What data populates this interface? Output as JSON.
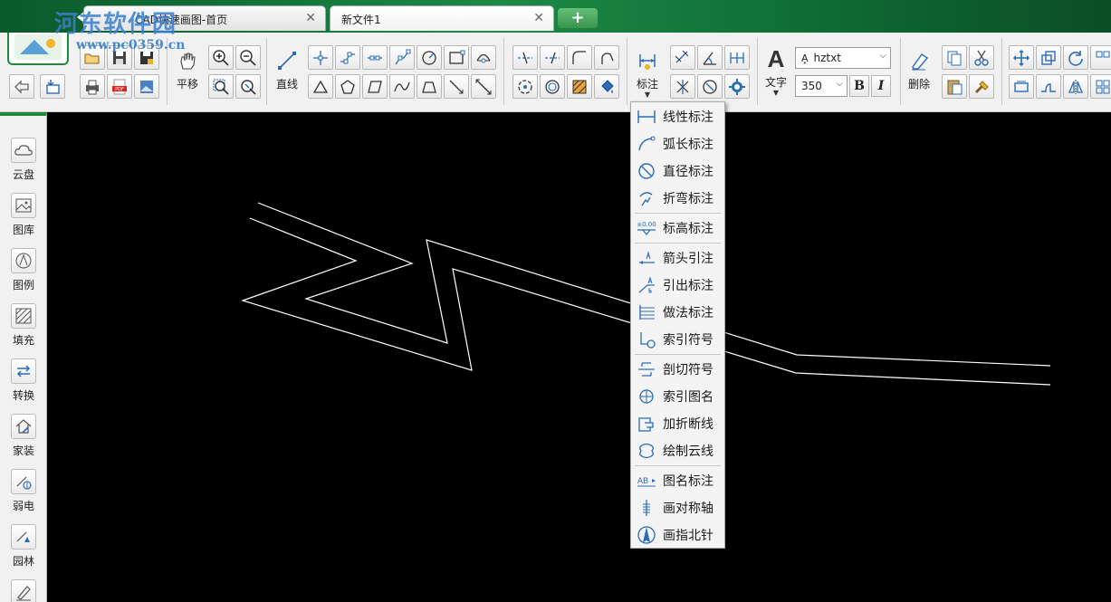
{
  "window": {
    "watermark": "河东软件园",
    "watermark_url": "www.pc0359.cn"
  },
  "tabs": [
    {
      "label": "CAD快速画图-首页",
      "close": "✕"
    },
    {
      "label": "新文件1",
      "close": "✕"
    }
  ],
  "add_tab": "+",
  "ribbon": {
    "pan_label": "平移",
    "line_label": "直线",
    "dim_label": "标注",
    "text_label": "文字",
    "text_glyph": "A",
    "delete_label": "删除",
    "font_select": "hztxt",
    "font_select_prefix": "A͓",
    "size_select": "350",
    "bold": "B",
    "italic": "I"
  },
  "left_palette": [
    {
      "label": "云盘",
      "icon": "cloud-icon"
    },
    {
      "label": "图库",
      "icon": "gallery-icon"
    },
    {
      "label": "图例",
      "icon": "legend-icon"
    },
    {
      "label": "填充",
      "icon": "hatch-icon"
    },
    {
      "label": "转换",
      "icon": "convert-icon"
    },
    {
      "label": "家装",
      "icon": "home-decor-icon"
    },
    {
      "label": "弱电",
      "icon": "low-voltage-icon"
    },
    {
      "label": "园林",
      "icon": "garden-icon"
    },
    {
      "label": "",
      "icon": "pen-icon"
    }
  ],
  "dim_menu": {
    "items": [
      {
        "label": "线性标注",
        "icon": "linear-dimension-icon"
      },
      {
        "label": "弧长标注",
        "icon": "arc-length-icon"
      },
      {
        "label": "直径标注",
        "icon": "diameter-icon"
      },
      {
        "label": "折弯标注",
        "icon": "jogged-dimension-icon"
      },
      {
        "label": "标高标注",
        "icon": "elevation-icon"
      },
      {
        "label": "箭头引注",
        "icon": "arrow-leader-icon"
      },
      {
        "label": "引出标注",
        "icon": "leader-icon"
      },
      {
        "label": "做法标注",
        "icon": "method-note-icon"
      },
      {
        "label": "索引符号",
        "icon": "index-symbol-icon"
      },
      {
        "label": "剖切符号",
        "icon": "section-symbol-icon"
      },
      {
        "label": "索引图名",
        "icon": "index-title-icon"
      },
      {
        "label": "加折断线",
        "icon": "break-line-icon"
      },
      {
        "label": "绘制云线",
        "icon": "revision-cloud-icon"
      },
      {
        "label": "图名标注",
        "icon": "drawing-title-icon"
      },
      {
        "label": "画对称轴",
        "icon": "symmetry-axis-icon"
      },
      {
        "label": "画指北针",
        "icon": "north-arrow-icon"
      }
    ],
    "label_small": "±0.00",
    "label_ab": "AB"
  },
  "colors": {
    "accent": "#1f8a3c",
    "icon_blue": "#2b6cb8",
    "canvas": "#000000",
    "drawing": "#ffffff"
  }
}
